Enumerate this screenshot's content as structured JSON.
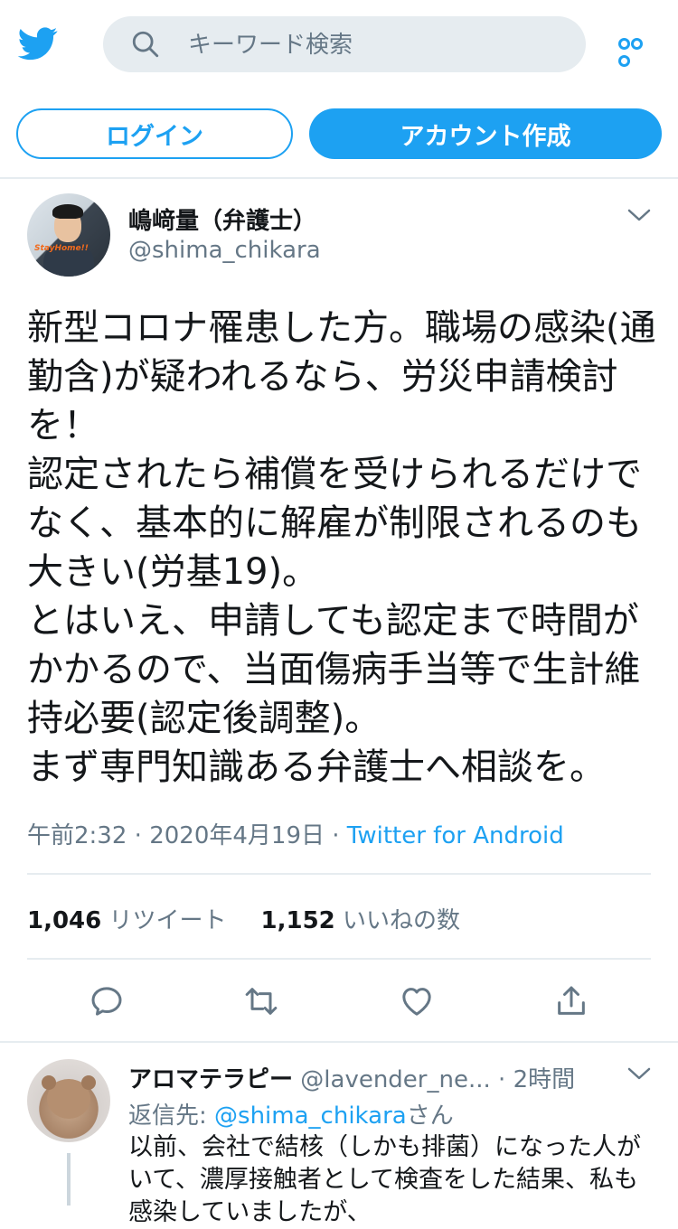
{
  "colors": {
    "accent": "#1da1f2",
    "secondary_text": "#657786",
    "divider": "#e6ecf0"
  },
  "header": {
    "logo_icon": "twitter-bird-icon",
    "search_placeholder": "キーワード検索",
    "more_icon": "more-dots-icon"
  },
  "auth": {
    "login_label": "ログイン",
    "signup_label": "アカウント作成"
  },
  "tweet": {
    "author_name": "嶋﨑量（弁護士）",
    "author_handle": "@shima_chikara",
    "avatar_text": "StayHome!!",
    "text": "新型コロナ罹患した方。職場の感染(通勤含)が疑われるなら、労災申請検討を！\n認定されたら補償を受けられるだけでなく、基本的に解雇が制限されるのも大きい(労基19)。\nとはいえ、申請しても認定まで時間がかかるので、当面傷病手当等で生計維持必要(認定後調整)。\nまず専門知識ある弁護士へ相談を。",
    "time": "午前2:32",
    "sep": "·",
    "date": "2020年4月19日",
    "source": "Twitter for Android",
    "retweet_count": "1,046",
    "retweet_label": "リツイート",
    "like_count": "1,152",
    "like_label": "いいねの数",
    "actions": [
      "reply-icon",
      "retweet-icon",
      "like-icon",
      "share-icon"
    ]
  },
  "reply": {
    "author_name": "アロマテラピー",
    "author_handle": "@lavender_ne...",
    "sep": "·",
    "time": "2時間",
    "reply_prefix": "返信先: ",
    "reply_mention": "@shima_chikara",
    "reply_suffix": "さん",
    "text": "以前、会社で結核（しかも排菌）になった人がいて、濃厚接触者として検査をした結果、私も感染していましたが、"
  }
}
